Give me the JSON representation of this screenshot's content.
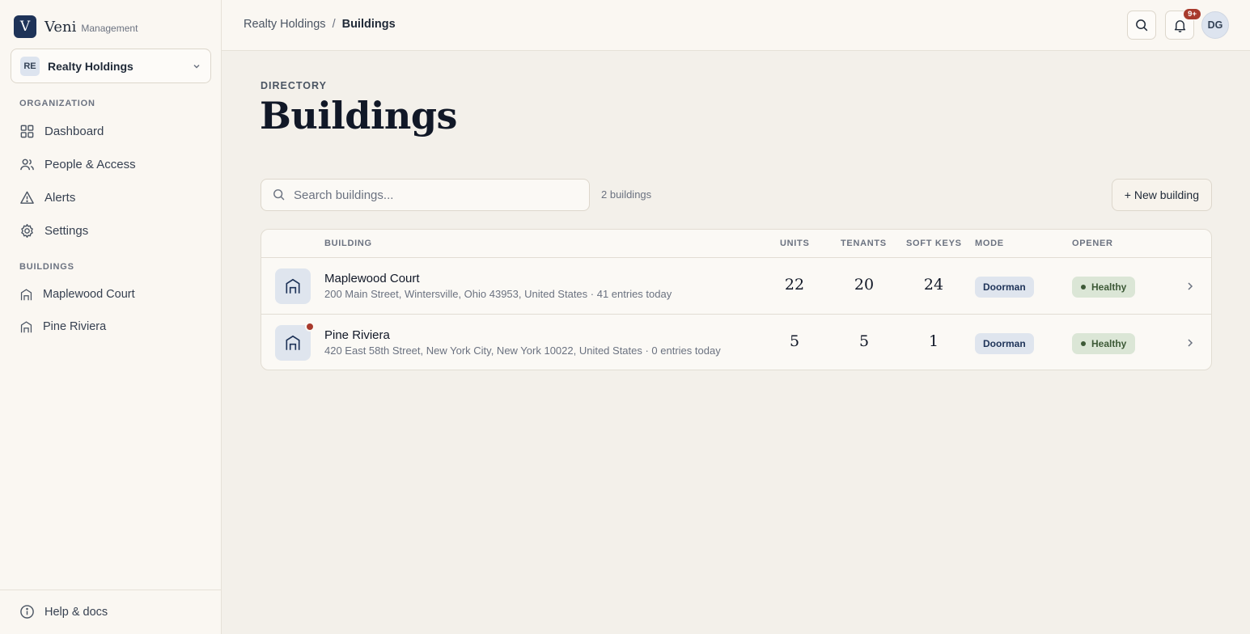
{
  "app": {
    "brand_letter": "V",
    "name": "Veni",
    "subtitle": "Management"
  },
  "org": {
    "badge": "RE",
    "name": "Realty Holdings"
  },
  "sidebar": {
    "org_section": "ORGANIZATION",
    "nav": [
      {
        "label": "Dashboard",
        "icon": "grid-icon"
      },
      {
        "label": "People & Access",
        "icon": "users-icon"
      },
      {
        "label": "Alerts",
        "icon": "warning-icon"
      },
      {
        "label": "Settings",
        "icon": "gear-icon"
      }
    ],
    "buildings_section": "BUILDINGS",
    "buildings": [
      {
        "label": "Maplewood Court",
        "icon": "building-icon"
      },
      {
        "label": "Pine Riviera",
        "icon": "building-icon"
      }
    ],
    "help": "Help & docs"
  },
  "header": {
    "breadcrumb": [
      "Realty Holdings",
      "Buildings"
    ],
    "separator": "/",
    "notifications_badge": "9+",
    "avatar": "DG"
  },
  "page": {
    "eyebrow": "DIRECTORY",
    "title": "Buildings",
    "search_placeholder": "Search buildings...",
    "count": "2 buildings",
    "new_button": "+ New building"
  },
  "table": {
    "columns": {
      "building": "BUILDING",
      "units": "UNITS",
      "tenants": "TENANTS",
      "soft_keys": "SOFT KEYS",
      "mode": "MODE",
      "opener": "OPENER"
    },
    "rows": [
      {
        "name": "Maplewood Court",
        "address": "200 Main Street, Wintersville, Ohio 43953, United States · 41 entries today",
        "units": "22",
        "tenants": "20",
        "soft_keys": "24",
        "mode": "Doorman",
        "opener": "Healthy",
        "has_alert": false
      },
      {
        "name": "Pine Riviera",
        "address": "420 East 58th Street, New York City, New York 10022, United States · 0 entries today",
        "units": "5",
        "tenants": "5",
        "soft_keys": "1",
        "mode": "Doorman",
        "opener": "Healthy",
        "has_alert": true
      }
    ]
  },
  "colors": {
    "brand": "#1e3358",
    "alert": "#a83a2c",
    "healthy_bg": "#dbe6d6",
    "healthy_text": "#3d5a37"
  }
}
